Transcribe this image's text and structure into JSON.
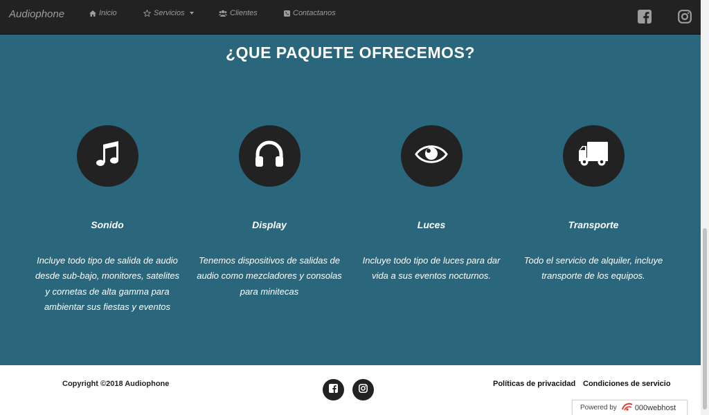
{
  "nav": {
    "brand": "Audiophone",
    "items": [
      {
        "label": "Inicio",
        "icon": "home-icon"
      },
      {
        "label": "Servicios",
        "icon": "star-icon",
        "dropdown": true
      },
      {
        "label": "Clientes",
        "icon": "users-icon"
      },
      {
        "label": "Contactanos",
        "icon": "phone-icon"
      }
    ],
    "social": [
      "facebook-icon",
      "instagram-icon"
    ]
  },
  "section": {
    "title": "¿QUE PAQUETE OFRECEMOS?",
    "cards": [
      {
        "title": "Sonido",
        "icon": "music-icon",
        "description": "Incluye todo tipo de salida de audio desde sub-bajo, monitores, satelites y cornetas de alta gamma para ambientar sus fiestas y eventos"
      },
      {
        "title": "Display",
        "icon": "headphones-icon",
        "description": "Tenemos dispositivos de salidas de audio como mezcladores y consolas para minitecas"
      },
      {
        "title": "Luces",
        "icon": "eye-icon",
        "description": "Incluye todo tipo de luces para dar vida a sus eventos nocturnos."
      },
      {
        "title": "Transporte",
        "icon": "truck-icon",
        "description": "Todo el servicio de alquiler, incluye transporte de los equipos."
      }
    ]
  },
  "footer": {
    "copyright": "Copyright ©2018 Audiophone",
    "links": [
      "Políticas de privacidad",
      "Condiciones de servicio"
    ],
    "badge": {
      "prefix": "Powered by",
      "name": "000webhost"
    }
  },
  "colors": {
    "navbar": "#222222",
    "section": "#2a677c",
    "nav_text": "#9d9d9d",
    "circle": "#222222"
  }
}
